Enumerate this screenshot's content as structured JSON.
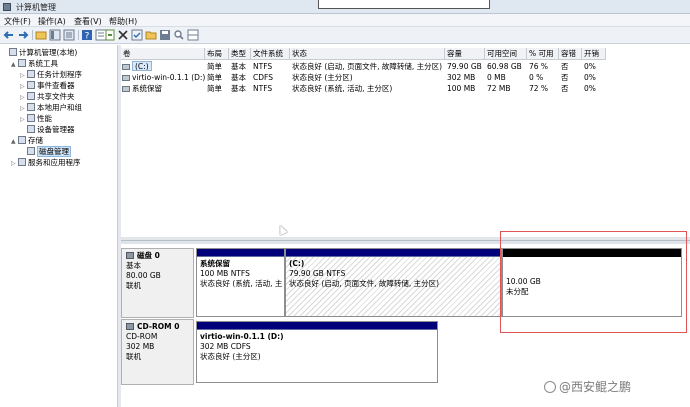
{
  "window": {
    "title": "计算机管理"
  },
  "menu": [
    "文件(F)",
    "操作(A)",
    "查看(V)",
    "帮助(H)"
  ],
  "toolbar": [
    {
      "icon": "back-arrow-icon",
      "color": "#2c6db5"
    },
    {
      "icon": "forward-arrow-icon",
      "color": "#2c6db5"
    },
    {
      "icon": "up-folder-icon",
      "color": "#d8a531"
    },
    {
      "icon": "show-hide-tree-icon",
      "color": "#6c7c91"
    },
    {
      "icon": "help-icon",
      "color": "#2e64b3"
    },
    {
      "icon": "properties-icon",
      "color": "#6c7c91"
    },
    {
      "icon": "export-list-icon",
      "color": "#5b8f3a"
    },
    {
      "icon": "delete-x-icon",
      "color": "#333333"
    },
    {
      "icon": "check-icon",
      "color": "#6c7c91"
    },
    {
      "icon": "open-folder-icon",
      "color": "#d8a531"
    },
    {
      "icon": "save-icon",
      "color": "#6c7c91"
    },
    {
      "icon": "zoom-icon",
      "color": "#6c7c91"
    },
    {
      "icon": "panes-icon",
      "color": "#6c7c91"
    }
  ],
  "tree": [
    {
      "label": "计算机管理(本地)",
      "indent": 0,
      "expander": ""
    },
    {
      "label": "系统工具",
      "indent": 1,
      "expander": "▲"
    },
    {
      "label": "任务计划程序",
      "indent": 2,
      "expander": "▷"
    },
    {
      "label": "事件查看器",
      "indent": 2,
      "expander": "▷"
    },
    {
      "label": "共享文件夹",
      "indent": 2,
      "expander": "▷"
    },
    {
      "label": "本地用户和组",
      "indent": 2,
      "expander": "▷"
    },
    {
      "label": "性能",
      "indent": 2,
      "expander": "▷"
    },
    {
      "label": "设备管理器",
      "indent": 2,
      "expander": ""
    },
    {
      "label": "存储",
      "indent": 1,
      "expander": "▲"
    },
    {
      "label": "磁盘管理",
      "indent": 2,
      "expander": "",
      "selected": true
    },
    {
      "label": "服务和应用程序",
      "indent": 1,
      "expander": "▷"
    }
  ],
  "volumes": {
    "columns": [
      "卷",
      "布局",
      "类型",
      "文件系统",
      "状态",
      "容量",
      "可用空间",
      "% 可用",
      "容错",
      "开销"
    ],
    "rows": [
      [
        "(C:)",
        "简单",
        "基本",
        "NTFS",
        "状态良好 (启动, 页面文件, 故障转储, 主分区)",
        "79.90 GB",
        "60.98 GB",
        "76 %",
        "否",
        "0%"
      ],
      [
        "virtio-win-0.1.1 (D:)",
        "简单",
        "基本",
        "CDFS",
        "状态良好 (主分区)",
        "302 MB",
        "0 MB",
        "0 %",
        "否",
        "0%"
      ],
      [
        "系统保留",
        "简单",
        "基本",
        "NTFS",
        "状态良好 (系统, 活动, 主分区)",
        "100 MB",
        "72 MB",
        "72 %",
        "否",
        "0%"
      ]
    ]
  },
  "disks": [
    {
      "name": "磁盘 0",
      "kind": "基本",
      "size": "80.00 GB",
      "status": "联机",
      "partitions": [
        {
          "title": "系统保留",
          "line2": "100 MB NTFS",
          "line3": "状态良好 (系统, 活动, 主"
        },
        {
          "title": "(C:)",
          "line2": "79.90 GB NTFS",
          "line3": "状态良好 (启动, 页面文件, 故障转储, 主分区)"
        },
        {
          "title": "",
          "line2": "10.00 GB",
          "line3": "未分配"
        }
      ]
    },
    {
      "name": "CD-ROM 0",
      "kind": "CD-ROM",
      "size": "302 MB",
      "status": "联机",
      "partitions": [
        {
          "title": "virtio-win-0.1.1 (D:)",
          "line2": "302 MB CDFS",
          "line3": "状态良好 (主分区)"
        }
      ]
    }
  ],
  "watermark": "@西安鲲之鹏",
  "colors": {
    "partition_band": "#00007a",
    "unallocated_band": "#000000",
    "highlight": "#e05555"
  }
}
